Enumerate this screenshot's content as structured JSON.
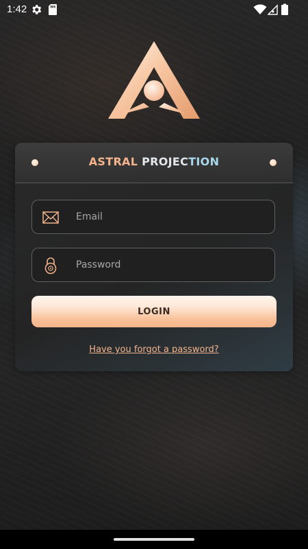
{
  "status_bar": {
    "time": "1:42",
    "icons": [
      "settings-gear-icon",
      "sd-card-icon",
      "wifi-icon",
      "signal-icon",
      "battery-icon"
    ]
  },
  "app": {
    "logo_icon": "astral-triangle-logo-icon",
    "title_part1": "ASTRAL",
    "title_part2": " PROJEC",
    "title_part3": "TION"
  },
  "login_form": {
    "email": {
      "icon": "envelope-icon",
      "placeholder": "Email",
      "value": ""
    },
    "password": {
      "icon": "padlock-icon",
      "placeholder": "Password",
      "value": ""
    },
    "login_button_label": "LOGIN",
    "forgot_password_link": "Have you forgot a password?"
  },
  "colors": {
    "accent": "#f3b48c",
    "button_gradient_top": "#fff6ef",
    "button_gradient_bottom": "#f6b489",
    "card_background": "#2a2a2a",
    "title_cyan": "#a9d8ea"
  }
}
